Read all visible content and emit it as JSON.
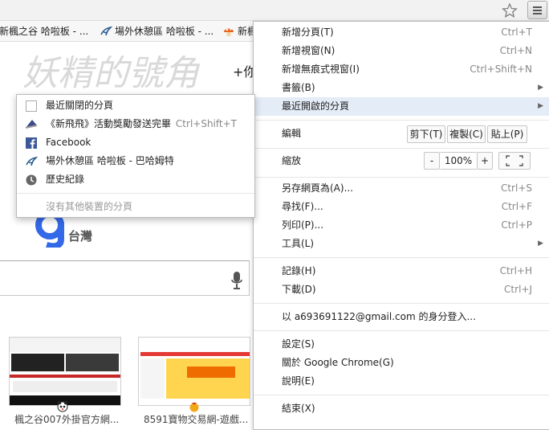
{
  "bookmarks_bar": {
    "items": [
      {
        "label": "新楓之谷 哈啦板 - ..."
      },
      {
        "label": "場外休憩區 哈啦板 - ..."
      },
      {
        "label": "新楓"
      }
    ]
  },
  "page": {
    "logo_text": "妖精的號角",
    "plus_you": "+你",
    "google_region": "台灣",
    "thumbnails": [
      {
        "label": "楓之谷007外掛官方網..."
      },
      {
        "label": "8591寶物交易網-遊戲..."
      }
    ]
  },
  "recent_tabs_menu": {
    "items": [
      {
        "label": "最近關閉的分頁",
        "shortcut": ""
      },
      {
        "label": "《新飛飛》活動獎勵發送完畢",
        "shortcut": "Ctrl+Shift+T"
      },
      {
        "label": "Facebook",
        "shortcut": ""
      },
      {
        "label": "場外休憩區 哈啦板 - 巴哈姆特",
        "shortcut": ""
      },
      {
        "label": "歷史紀錄",
        "shortcut": ""
      }
    ],
    "no_other_devices": "沒有其他裝置的分頁"
  },
  "main_menu": {
    "new_tab": {
      "label": "新增分頁(T)",
      "shortcut": "Ctrl+T"
    },
    "new_window": {
      "label": "新增視窗(N)",
      "shortcut": "Ctrl+N"
    },
    "new_incognito": {
      "label": "新增無痕式視窗(I)",
      "shortcut": "Ctrl+Shift+N"
    },
    "bookmarks": {
      "label": "書籤(B)"
    },
    "recent_tabs": {
      "label": "最近開啟的分頁"
    },
    "edit": {
      "label": "編輯",
      "cut": "剪下(T)",
      "copy": "複製(C)",
      "paste": "貼上(P)"
    },
    "zoom": {
      "label": "縮放",
      "minus": "-",
      "level": "100%",
      "plus": "+"
    },
    "save_page": {
      "label": "另存網頁為(A)...",
      "shortcut": "Ctrl+S"
    },
    "find": {
      "label": "尋找(F)...",
      "shortcut": "Ctrl+F"
    },
    "print": {
      "label": "列印(P)...",
      "shortcut": "Ctrl+P"
    },
    "tools": {
      "label": "工具(L)"
    },
    "history": {
      "label": "記錄(H)",
      "shortcut": "Ctrl+H"
    },
    "downloads": {
      "label": "下載(D)",
      "shortcut": "Ctrl+J"
    },
    "sign_in": {
      "label": "以 a693691122@gmail.com 的身分登入..."
    },
    "settings": {
      "label": "設定(S)"
    },
    "about": {
      "label": "關於 Google Chrome(G)"
    },
    "help": {
      "label": "說明(E)"
    },
    "exit": {
      "label": "結束(X)"
    }
  },
  "colors": {
    "google_blue": "#3369e8",
    "google_red": "#d50f25",
    "google_yellow": "#eeb211",
    "google_green": "#009925",
    "facebook_blue": "#3b5998"
  }
}
